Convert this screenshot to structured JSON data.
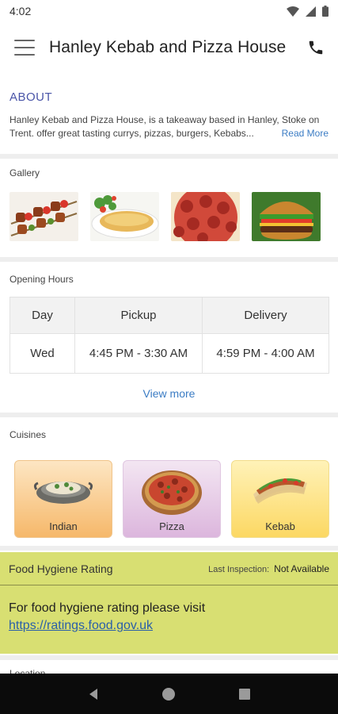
{
  "status_bar": {
    "time": "4:02"
  },
  "app_bar": {
    "title": "Hanley Kebab and Pizza House"
  },
  "about": {
    "heading": "ABOUT",
    "text": "Hanley Kebab and Pizza House, is a takeaway based in Hanley, Stoke on Trent. offer great tasting currys, pizzas, burgers, Kebabs...",
    "read_more": "Read More"
  },
  "gallery": {
    "label": "Gallery",
    "items": [
      "kebab skewers",
      "omelette",
      "pepperoni pizza",
      "burger"
    ]
  },
  "opening_hours": {
    "label": "Opening Hours",
    "headers": [
      "Day",
      "Pickup",
      "Delivery"
    ],
    "rows": [
      {
        "day": "Wed",
        "pickup": "4:45 PM - 3:30 AM",
        "delivery": "4:59 PM - 4:00 AM"
      }
    ],
    "view_more": "View more"
  },
  "cuisines": {
    "label": "Cuisines",
    "items": [
      {
        "name": "Indian"
      },
      {
        "name": "Pizza"
      },
      {
        "name": "Kebab"
      }
    ]
  },
  "food_hygiene": {
    "title": "Food Hygiene Rating",
    "last_inspection_label": "Last Inspection:",
    "last_inspection_value": "Not Available",
    "message": "For food hygiene rating please visit",
    "link": "https://ratings.food.gov.uk"
  },
  "location": {
    "label": "Location"
  },
  "colors": {
    "accent": "#4a55a8",
    "link": "#3b7cc4",
    "hygiene_bg": "#d8df72"
  }
}
